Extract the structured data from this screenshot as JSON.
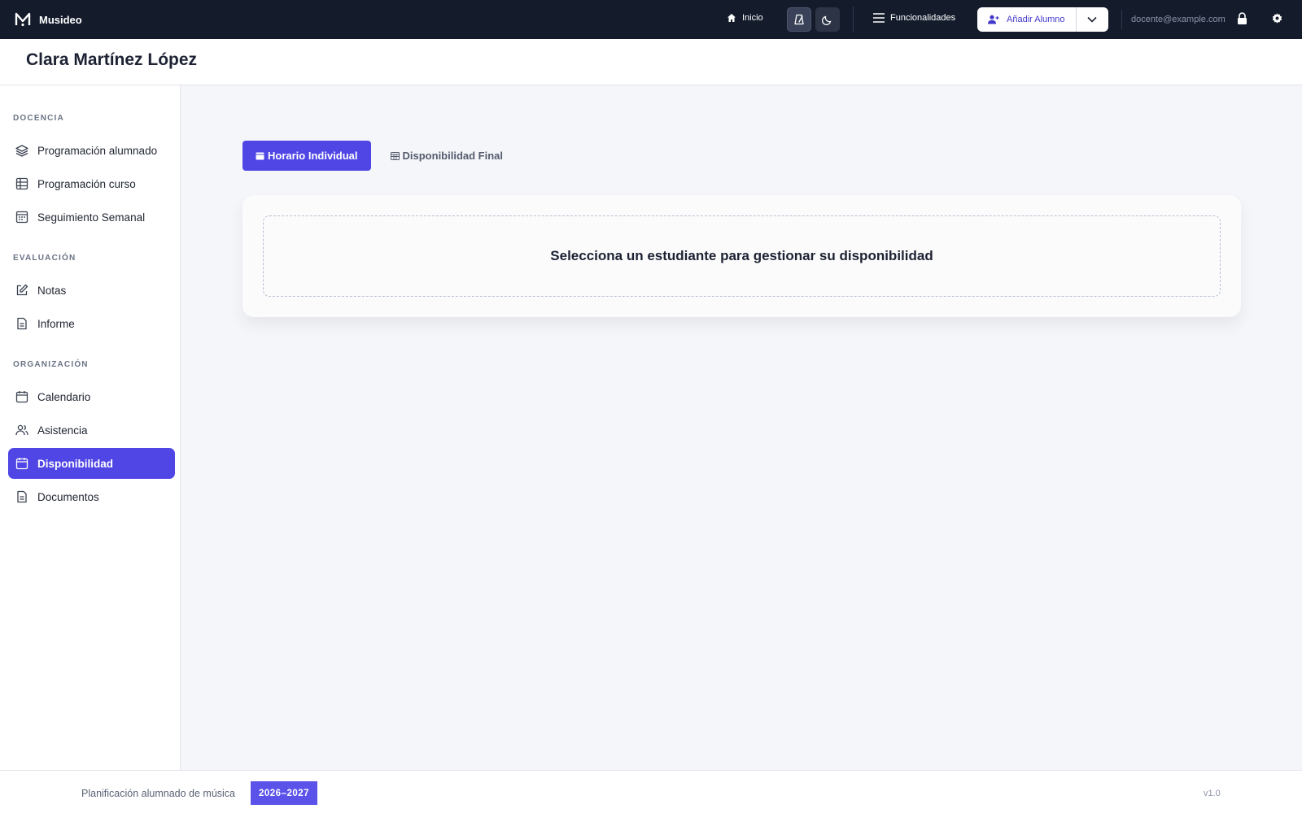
{
  "app": {
    "name": "Musideo"
  },
  "topbar": {
    "home_label": "Inicio",
    "features_label": "Funcionalidades",
    "add_student_label": "Añadir Alumno",
    "user_email": "docente@example.com"
  },
  "page": {
    "title": "Clara Martínez López"
  },
  "sidebar": {
    "sections": [
      {
        "label": "DOCENCIA"
      },
      {
        "label": "EVALUACIÓN"
      },
      {
        "label": "ORGANIZACIÓN"
      }
    ],
    "items": [
      {
        "label": "Programación alumnado",
        "icon": "layers-icon"
      },
      {
        "label": "Programación curso",
        "icon": "table-icon"
      },
      {
        "label": "Seguimiento Semanal",
        "icon": "calendar-week-icon"
      },
      {
        "label": "Notas",
        "icon": "edit-icon"
      },
      {
        "label": "Informe",
        "icon": "document-icon"
      },
      {
        "label": "Calendario",
        "icon": "calendar-icon"
      },
      {
        "label": "Asistencia",
        "icon": "users-icon"
      },
      {
        "label": "Disponibilidad",
        "icon": "calendar-icon",
        "active": true
      },
      {
        "label": "Documentos",
        "icon": "document-icon"
      }
    ]
  },
  "tabs": [
    {
      "label": "Horario Individual",
      "active": true
    },
    {
      "label": "Disponibilidad Final",
      "active": false
    }
  ],
  "main": {
    "empty_message": "Selecciona un estudiante para gestionar su disponibilidad"
  },
  "footer": {
    "text": "Planificación alumnado de música",
    "year_badge": "2026–2027",
    "version": "v1.0"
  },
  "colors": {
    "topbar_bg": "#141c2c",
    "accent": "#4f46e5",
    "background": "#f5f6f9"
  }
}
